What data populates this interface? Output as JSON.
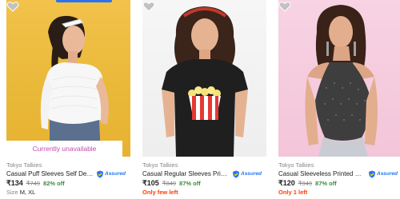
{
  "products": [
    {
      "brand": "Tokyo Talkies",
      "title": "Casual Puff Sleeves Self Design ...",
      "assured_label": "Assured",
      "price": "₹134",
      "mrp": "₹749",
      "discount": "82% off",
      "overlay": "Currently unavailable",
      "size_label": "Size",
      "sizes": "M, XL",
      "wishlist_icon": "heart-icon"
    },
    {
      "brand": "Tokyo Talkies",
      "title": "Casual Regular Sleeves Printed ...",
      "assured_label": "Assured",
      "price": "₹105",
      "mrp": "₹849",
      "discount": "87% off",
      "stock_note": "Only few left",
      "wishlist_icon": "heart-icon"
    },
    {
      "brand": "Tokyo Talkies",
      "title": "Casual Sleeveless Printed Wome...",
      "assured_label": "Assured",
      "price": "₹120",
      "mrp": "₹949",
      "discount": "87% off",
      "stock_note": "Only 1 left",
      "wishlist_icon": "heart-icon"
    }
  ],
  "colors": {
    "accent": "#2874f0",
    "discount": "#388e3c",
    "stock_warning": "#ff3d00",
    "unavailable": "#c04bb0"
  }
}
